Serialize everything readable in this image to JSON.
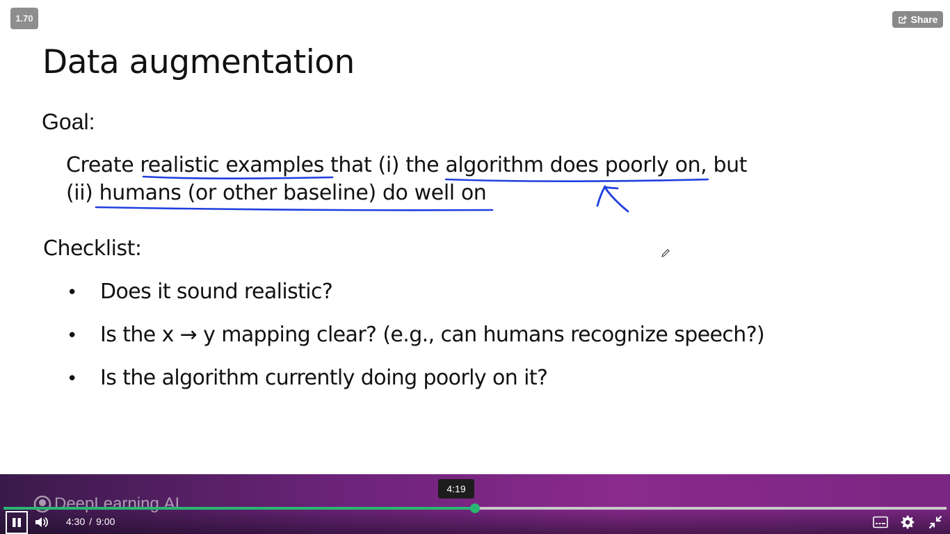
{
  "player": {
    "speed_label": "1.70",
    "share_label": "Share",
    "brand_name": "DeepLearning.AI",
    "tooltip_time": "4:19",
    "current_time": "4:30",
    "time_separator": "/",
    "duration": "9:00",
    "progress_fraction": 0.5,
    "icons": {
      "share": "share-icon",
      "pause": "pause-icon",
      "volume": "volume-icon",
      "captions": "captions-icon",
      "settings": "gear-icon",
      "exit_fullscreen": "exit-fullscreen-icon",
      "pen_cursor": "pen-cursor-icon"
    },
    "colors": {
      "progress": "#2bb673",
      "ink": "#1f3fe0",
      "bar_purple": "#8a2a8e"
    }
  },
  "slide": {
    "title": "Data augmentation",
    "goal_heading": "Goal:",
    "goal_line_1": "Create realistic examples that (i) the algorithm does poorly on, but",
    "goal_line_2": "(ii) humans (or other baseline) do well on",
    "checklist_heading": "Checklist:",
    "checklist": [
      {
        "bullet": "•",
        "text": "Does it sound realistic?"
      },
      {
        "bullet": "•",
        "text": "Is the x → y mapping clear? (e.g., can humans recognize speech?)"
      },
      {
        "bullet": "•",
        "text": "Is the algorithm currently doing poorly on it?"
      }
    ]
  }
}
